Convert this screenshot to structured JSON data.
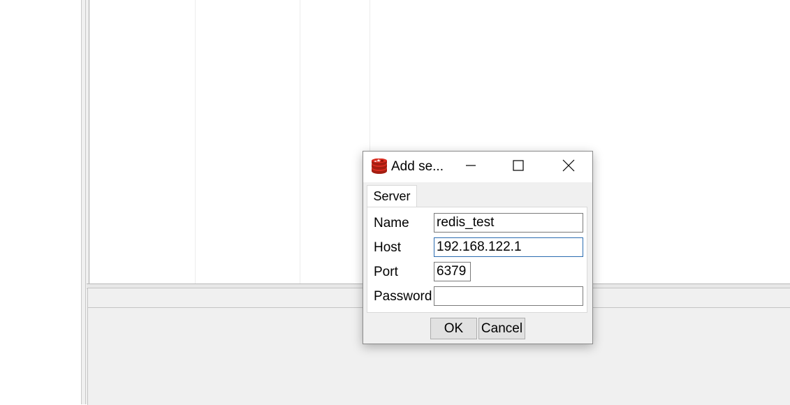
{
  "dialog": {
    "title": "Add se...",
    "tab_label": "Server",
    "fields": {
      "name": {
        "label": "Name",
        "value": "redis_test"
      },
      "host": {
        "label": "Host",
        "value": "192.168.122.1"
      },
      "port": {
        "label": "Port",
        "value": "6379"
      },
      "password": {
        "label": "Password",
        "value": ""
      }
    },
    "buttons": {
      "ok": "OK",
      "cancel": "Cancel"
    },
    "icons": {
      "app": "redis-icon",
      "minimize": "minimize-icon",
      "maximize": "maximize-icon",
      "close": "close-icon"
    }
  },
  "colors": {
    "redis_red": "#d82c20",
    "focus_border": "#2b6cb0",
    "window_bg": "#f0f0f0"
  }
}
